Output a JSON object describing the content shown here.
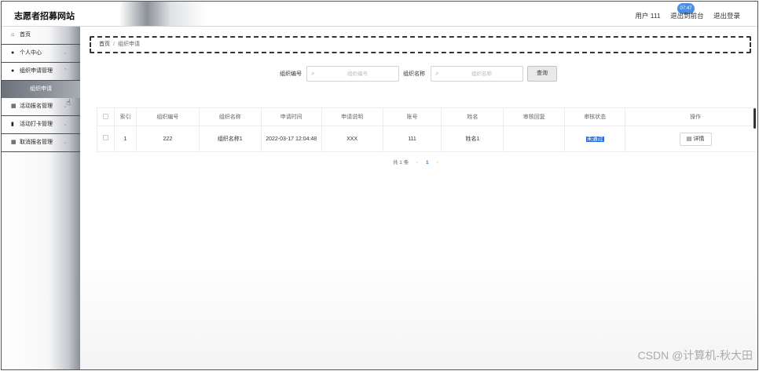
{
  "header": {
    "title": "志愿者招募网站",
    "user_label": "用户 111",
    "front_label": "退出到前台",
    "logout_label": "退出登录",
    "time_badge": "07:47"
  },
  "sidebar": {
    "items": [
      {
        "label": "首页",
        "icon": "home-icon",
        "glyph": "⌂",
        "chevron": ""
      },
      {
        "label": "个人中心",
        "icon": "user-icon",
        "glyph": "●",
        "chevron": "⌄"
      },
      {
        "label": "组织申请管理",
        "icon": "user-icon",
        "glyph": "●",
        "chevron": "⌃"
      },
      {
        "label": "活动报名管理",
        "icon": "grid-icon",
        "glyph": "▦",
        "chevron": "⌄"
      },
      {
        "label": "活动打卡管理",
        "icon": "bar-chart-icon",
        "glyph": "▮",
        "chevron": "⌄"
      },
      {
        "label": "取消报名管理",
        "icon": "grid-icon",
        "glyph": "▦",
        "chevron": "⌄"
      }
    ],
    "submenu": {
      "label": "组织申请"
    }
  },
  "breadcrumb": {
    "home": "首页",
    "current": "组织申请"
  },
  "search": {
    "org_no_label": "组织编号",
    "org_no_placeholder": "组织编号",
    "org_name_label": "组织名称",
    "org_name_placeholder": "组织名称",
    "button": "查询"
  },
  "table": {
    "columns": [
      "索引",
      "组织编号",
      "组织名称",
      "申请时间",
      "申请说明",
      "账号",
      "姓名",
      "审核回复",
      "审核状态",
      "操作"
    ],
    "rows": [
      {
        "index": "1",
        "org_no": "222",
        "org_name": "组织名称1",
        "apply_time": "2022-03-17 12:04:48",
        "desc": "XXX",
        "account": "111",
        "name": "姓名1",
        "reply": "",
        "status": "未通过",
        "action": "详情"
      }
    ]
  },
  "pager": {
    "total": "共 1 条",
    "prev": "‹",
    "page": "1",
    "next": "›"
  },
  "watermark": "CSDN @计算机-秋大田",
  "colors": {
    "status_badge": "#2a6fdc",
    "time_badge": "#4a8fe6",
    "page_current": "#1a7fd4"
  }
}
